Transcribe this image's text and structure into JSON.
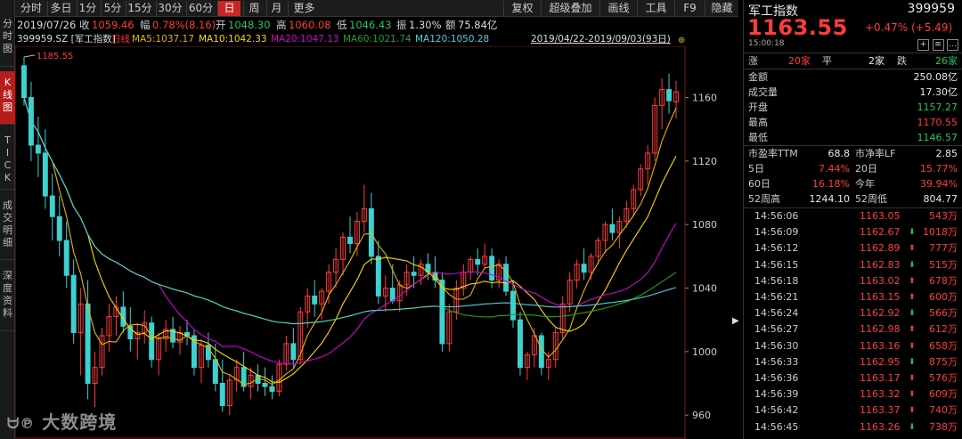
{
  "left_tabs": [
    {
      "label": "分时图",
      "active": false
    },
    {
      "label": "K线图",
      "active": true
    },
    {
      "label": "TICK",
      "active": false
    },
    {
      "label": "成交明细",
      "active": false
    },
    {
      "label": "深度资料",
      "active": false
    }
  ],
  "toolbar": {
    "periods": [
      "分时",
      "多日",
      "1分",
      "5分",
      "15分",
      "30分",
      "60分",
      "日",
      "周",
      "月",
      "更多"
    ],
    "active_period": "日",
    "right_buttons": [
      "复权",
      "超级叠加",
      "画线",
      "工具",
      "F9",
      "隐藏"
    ]
  },
  "info": {
    "date": "2019/07/26",
    "close_label": "收",
    "close": "1059.46",
    "range_label": "幅",
    "range": "0.78%(8.16)",
    "open_label": "开",
    "open": "1048.30",
    "high_label": "高",
    "high": "1060.08",
    "low_label": "低",
    "low": "1046.43",
    "amp_label": "振",
    "amp": "1.30%",
    "amount_label": "额",
    "amount": "75.84亿"
  },
  "ma_row": {
    "code": "399959.SZ [军工指数]",
    "daily": "日线",
    "ma5": "MA5:1037.17",
    "ma10": "MA10:1042.33",
    "ma20": "MA20:1047.13",
    "ma60": "MA60:1021.74",
    "ma120": "MA120:1050.28",
    "date_range": "2019/04/22-2019/09/03(93日)"
  },
  "chart_data": {
    "type": "candlestick",
    "y_ticks": [
      "1160",
      "1120",
      "1080",
      "1040",
      "1000",
      "960"
    ],
    "ylim": [
      950,
      1190
    ],
    "high_marker": "1185.55",
    "candles": [
      [
        1180,
        1185.55,
        1155,
        1160
      ],
      [
        1160,
        1170,
        1120,
        1130
      ],
      [
        1130,
        1148,
        1110,
        1125
      ],
      [
        1125,
        1140,
        1090,
        1098
      ],
      [
        1098,
        1112,
        1070,
        1085
      ],
      [
        1085,
        1098,
        1060,
        1070
      ],
      [
        1070,
        1082,
        1040,
        1048
      ],
      [
        1048,
        1058,
        1005,
        1012
      ],
      [
        1012,
        1040,
        985,
        1030
      ],
      [
        1030,
        1045,
        970,
        980
      ],
      [
        980,
        1000,
        965,
        990
      ],
      [
        990,
        1015,
        985,
        1010
      ],
      [
        1010,
        1030,
        1000,
        1022
      ],
      [
        1022,
        1035,
        1010,
        1028
      ],
      [
        1028,
        1038,
        1012,
        1016
      ],
      [
        1016,
        1028,
        1000,
        1008
      ],
      [
        1008,
        1018,
        995,
        1012
      ],
      [
        1012,
        1026,
        1005,
        1018
      ],
      [
        1018,
        1022,
        990,
        995
      ],
      [
        995,
        1012,
        985,
        1008
      ],
      [
        1008,
        1020,
        1000,
        1014
      ],
      [
        1014,
        1022,
        1002,
        1006
      ],
      [
        1006,
        1016,
        998,
        1012
      ],
      [
        1012,
        1020,
        1004,
        1010
      ],
      [
        1010,
        1014,
        985,
        990
      ],
      [
        990,
        1008,
        980,
        1004
      ],
      [
        1004,
        1012,
        990,
        995
      ],
      [
        995,
        1005,
        975,
        980
      ],
      [
        980,
        995,
        962,
        966
      ],
      [
        966,
        985,
        960,
        982
      ],
      [
        982,
        995,
        975,
        990
      ],
      [
        990,
        1000,
        975,
        978
      ],
      [
        978,
        990,
        970,
        985
      ],
      [
        985,
        992,
        975,
        980
      ],
      [
        980,
        990,
        972,
        978
      ],
      [
        978,
        985,
        970,
        975
      ],
      [
        975,
        995,
        972,
        992
      ],
      [
        992,
        1010,
        988,
        1005
      ],
      [
        1005,
        1015,
        990,
        995
      ],
      [
        995,
        1028,
        992,
        1025
      ],
      [
        1025,
        1040,
        1015,
        1035
      ],
      [
        1035,
        1045,
        1022,
        1030
      ],
      [
        1030,
        1040,
        1020,
        1038
      ],
      [
        1038,
        1055,
        1030,
        1050
      ],
      [
        1050,
        1065,
        1040,
        1058
      ],
      [
        1058,
        1075,
        1048,
        1072
      ],
      [
        1072,
        1085,
        1062,
        1068
      ],
      [
        1068,
        1088,
        1060,
        1082
      ],
      [
        1082,
        1105,
        1075,
        1090
      ],
      [
        1090,
        1100,
        1055,
        1060
      ],
      [
        1060,
        1070,
        1030,
        1035
      ],
      [
        1035,
        1048,
        1025,
        1040
      ],
      [
        1040,
        1055,
        1030,
        1032
      ],
      [
        1032,
        1045,
        1025,
        1042
      ],
      [
        1042,
        1055,
        1035,
        1050
      ],
      [
        1050,
        1060,
        1040,
        1048
      ],
      [
        1048,
        1058,
        1042,
        1055
      ],
      [
        1055,
        1062,
        1045,
        1050
      ],
      [
        1050,
        1060,
        1040,
        1045
      ],
      [
        1045,
        1050,
        1000,
        1005
      ],
      [
        1005,
        1030,
        1000,
        1025
      ],
      [
        1025,
        1045,
        1020,
        1040
      ],
      [
        1040,
        1055,
        1035,
        1050
      ],
      [
        1050,
        1060,
        1045,
        1058
      ],
      [
        1058,
        1065,
        1048,
        1055
      ],
      [
        1055,
        1068,
        1052,
        1060
      ],
      [
        1060,
        1065,
        1040,
        1045
      ],
      [
        1045,
        1058,
        1040,
        1055
      ],
      [
        1055,
        1060,
        1035,
        1038
      ],
      [
        1038,
        1045,
        1015,
        1020
      ],
      [
        1020,
        1025,
        985,
        990
      ],
      [
        990,
        1000,
        982,
        998
      ],
      [
        998,
        1015,
        990,
        1010
      ],
      [
        1010,
        1012,
        985,
        990
      ],
      [
        990,
        1000,
        982,
        995
      ],
      [
        995,
        1015,
        990,
        1012
      ],
      [
        1012,
        1035,
        1008,
        1030
      ],
      [
        1030,
        1050,
        1025,
        1045
      ],
      [
        1045,
        1058,
        1040,
        1055
      ],
      [
        1055,
        1065,
        1045,
        1050
      ],
      [
        1050,
        1062,
        1045,
        1060
      ],
      [
        1060,
        1072,
        1055,
        1070
      ],
      [
        1070,
        1082,
        1062,
        1080
      ],
      [
        1080,
        1090,
        1070,
        1075
      ],
      [
        1075,
        1085,
        1065,
        1082
      ],
      [
        1082,
        1095,
        1078,
        1090
      ],
      [
        1090,
        1105,
        1085,
        1102
      ],
      [
        1102,
        1118,
        1098,
        1115
      ],
      [
        1115,
        1130,
        1105,
        1125
      ],
      [
        1125,
        1160,
        1120,
        1155
      ],
      [
        1155,
        1172,
        1140,
        1165
      ],
      [
        1165,
        1175,
        1150,
        1158
      ],
      [
        1157.27,
        1170.55,
        1146.57,
        1163.55
      ]
    ],
    "ma_colors": {
      "daily": "#ff3333",
      "ma5": "#e8b400",
      "ma10": "#ffd700",
      "ma20": "#d100d1",
      "ma60": "#1fa31f",
      "ma120": "#4fd1d9"
    },
    "up_color": "#ff3b3b",
    "down_color": "#3fd0d0"
  },
  "quote": {
    "name": "军工指数",
    "code": "399959",
    "price": "1163.55",
    "change": "+0.47%",
    "change_abs": "(+5.49)",
    "time": "15:00:18",
    "breadth": {
      "up_label": "涨",
      "up": "20家",
      "flat_label": "平",
      "flat": "2家",
      "down_label": "跌",
      "down": "26家"
    },
    "stats": [
      {
        "k": "金额",
        "v": "250.08亿",
        "color": "white"
      },
      {
        "k": "成交量",
        "v": "17.30亿",
        "color": "white"
      },
      {
        "k": "开盘",
        "v": "1157.27",
        "color": "green"
      },
      {
        "k": "最高",
        "v": "1170.55",
        "color": "red"
      },
      {
        "k": "最低",
        "v": "1146.57",
        "color": "green"
      }
    ],
    "pe_label": "市盈率TTM",
    "pe": "68.8",
    "pb_label": "市净率LF",
    "pb": "2.85",
    "d5_label": "5日",
    "d5": "7.44%",
    "d20_label": "20日",
    "d20": "15.77%",
    "d60_label": "60日",
    "d60": "16.18%",
    "ytd_label": "今年",
    "ytd": "39.94%",
    "w52h_label": "52周高",
    "w52h": "1244.10",
    "w52l_label": "52周低",
    "w52l": "804.77"
  },
  "ticks": [
    {
      "time": "14:56:06",
      "price": "1163.05",
      "dir": "",
      "vol": "543万"
    },
    {
      "time": "14:56:09",
      "price": "1162.67",
      "dir": "down",
      "vol": "1018万"
    },
    {
      "time": "14:56:12",
      "price": "1162.89",
      "dir": "up",
      "vol": "777万"
    },
    {
      "time": "14:56:15",
      "price": "1162.83",
      "dir": "down",
      "vol": "515万"
    },
    {
      "time": "14:56:18",
      "price": "1163.02",
      "dir": "up",
      "vol": "678万"
    },
    {
      "time": "14:56:21",
      "price": "1163.15",
      "dir": "up",
      "vol": "600万"
    },
    {
      "time": "14:56:24",
      "price": "1162.92",
      "dir": "down",
      "vol": "566万"
    },
    {
      "time": "14:56:27",
      "price": "1162.98",
      "dir": "up",
      "vol": "612万"
    },
    {
      "time": "14:56:30",
      "price": "1163.16",
      "dir": "up",
      "vol": "658万"
    },
    {
      "time": "14:56:33",
      "price": "1162.95",
      "dir": "down",
      "vol": "875万"
    },
    {
      "time": "14:56:36",
      "price": "1163.17",
      "dir": "up",
      "vol": "576万"
    },
    {
      "time": "14:56:39",
      "price": "1163.32",
      "dir": "up",
      "vol": "609万"
    },
    {
      "time": "14:56:42",
      "price": "1163.37",
      "dir": "up",
      "vol": "740万"
    },
    {
      "time": "14:56:45",
      "price": "1163.26",
      "dir": "down",
      "vol": "738万"
    }
  ],
  "watermark": "大数跨境"
}
